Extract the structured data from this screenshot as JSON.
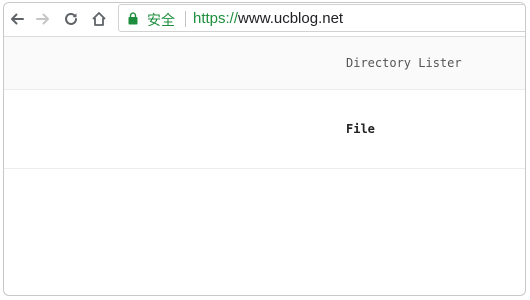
{
  "browser": {
    "security_label": "安全",
    "url_scheme": "https://",
    "url_host": "www.ucblog.net",
    "icons": [
      "back-icon",
      "forward-icon",
      "reload-icon",
      "home-icon",
      "lock-icon"
    ]
  },
  "page": {
    "title": "Directory Lister",
    "table": {
      "columns": [
        "File"
      ]
    }
  },
  "colors": {
    "secure_green": "#1e8e3e",
    "header_background": "#fafafa"
  }
}
